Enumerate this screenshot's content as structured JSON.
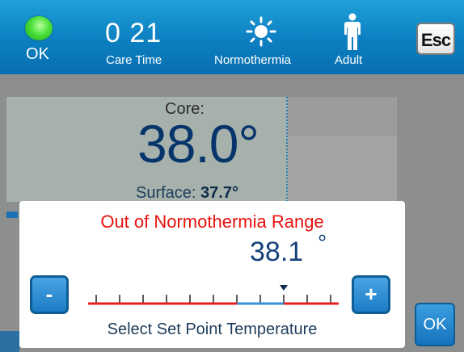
{
  "status_bar": {
    "status": "OK",
    "care_time_value": "0 21",
    "care_time_label": "Care Time",
    "mode_label": "Normothermia",
    "patient_label": "Adult",
    "esc_label": "Esc"
  },
  "readings": {
    "core_label": "Core:",
    "core_value": "38.0°",
    "surface_label": "Surface:",
    "surface_value": "37.7°"
  },
  "dialog": {
    "title": "Out of Normothermia Range",
    "value": "38.1",
    "degree": "°",
    "minus_label": "-",
    "plus_label": "+",
    "footer": "Select Set Point Temperature",
    "scale_tick_count": 11,
    "normal_range_ticks": [
      6,
      8
    ],
    "pointer_tick": 8
  },
  "ok_button_label": "OK",
  "colors": {
    "accent": "#0c7fc1",
    "warning": "#e8130f",
    "value": "#16427b"
  },
  "icons": {
    "status_ok": "green-led-icon",
    "mode": "sun-icon",
    "patient": "adult-person-icon"
  }
}
